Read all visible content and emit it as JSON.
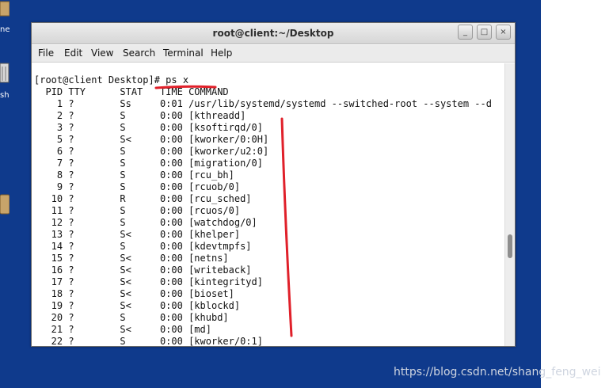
{
  "desktop": {
    "icons": [
      {
        "label": "ne",
        "icon": "home-folder-icon"
      },
      {
        "label": "sh",
        "icon": "trash-icon"
      },
      {
        "label": "",
        "icon": "folder-icon"
      }
    ]
  },
  "window": {
    "title": "root@client:~/Desktop",
    "buttons": {
      "minimize": "_",
      "maximize": "□",
      "close": "×"
    }
  },
  "menu": [
    "File",
    "Edit",
    "View",
    "Search",
    "Terminal",
    "Help"
  ],
  "terminal": {
    "prompt": "[root@client Desktop]#",
    "command": " ps x",
    "header": "  PID TTY      STAT   TIME COMMAND",
    "lines": [
      "    1 ?        Ss     0:01 /usr/lib/systemd/systemd --switched-root --system --d",
      "    2 ?        S      0:00 [kthreadd]",
      "    3 ?        S      0:00 [ksoftirqd/0]",
      "    5 ?        S<     0:00 [kworker/0:0H]",
      "    6 ?        S      0:00 [kworker/u2:0]",
      "    7 ?        S      0:00 [migration/0]",
      "    8 ?        S      0:00 [rcu_bh]",
      "    9 ?        S      0:00 [rcuob/0]",
      "   10 ?        R      0:00 [rcu_sched]",
      "   11 ?        S      0:00 [rcuos/0]",
      "   12 ?        S      0:00 [watchdog/0]",
      "   13 ?        S<     0:00 [khelper]",
      "   14 ?        S      0:00 [kdevtmpfs]",
      "   15 ?        S<     0:00 [netns]",
      "   16 ?        S<     0:00 [writeback]",
      "   17 ?        S<     0:00 [kintegrityd]",
      "   18 ?        S<     0:00 [bioset]",
      "   19 ?        S<     0:00 [kblockd]",
      "   20 ?        S      0:00 [khubd]",
      "   21 ?        S<     0:00 [md]",
      "   22 ?        S      0:00 [kworker/0:1]"
    ]
  },
  "watermark": "https://blog.csdn.net/shang_feng_wei",
  "colors": {
    "desktop": "#0f3a8c",
    "annotation": "#e0202a"
  }
}
